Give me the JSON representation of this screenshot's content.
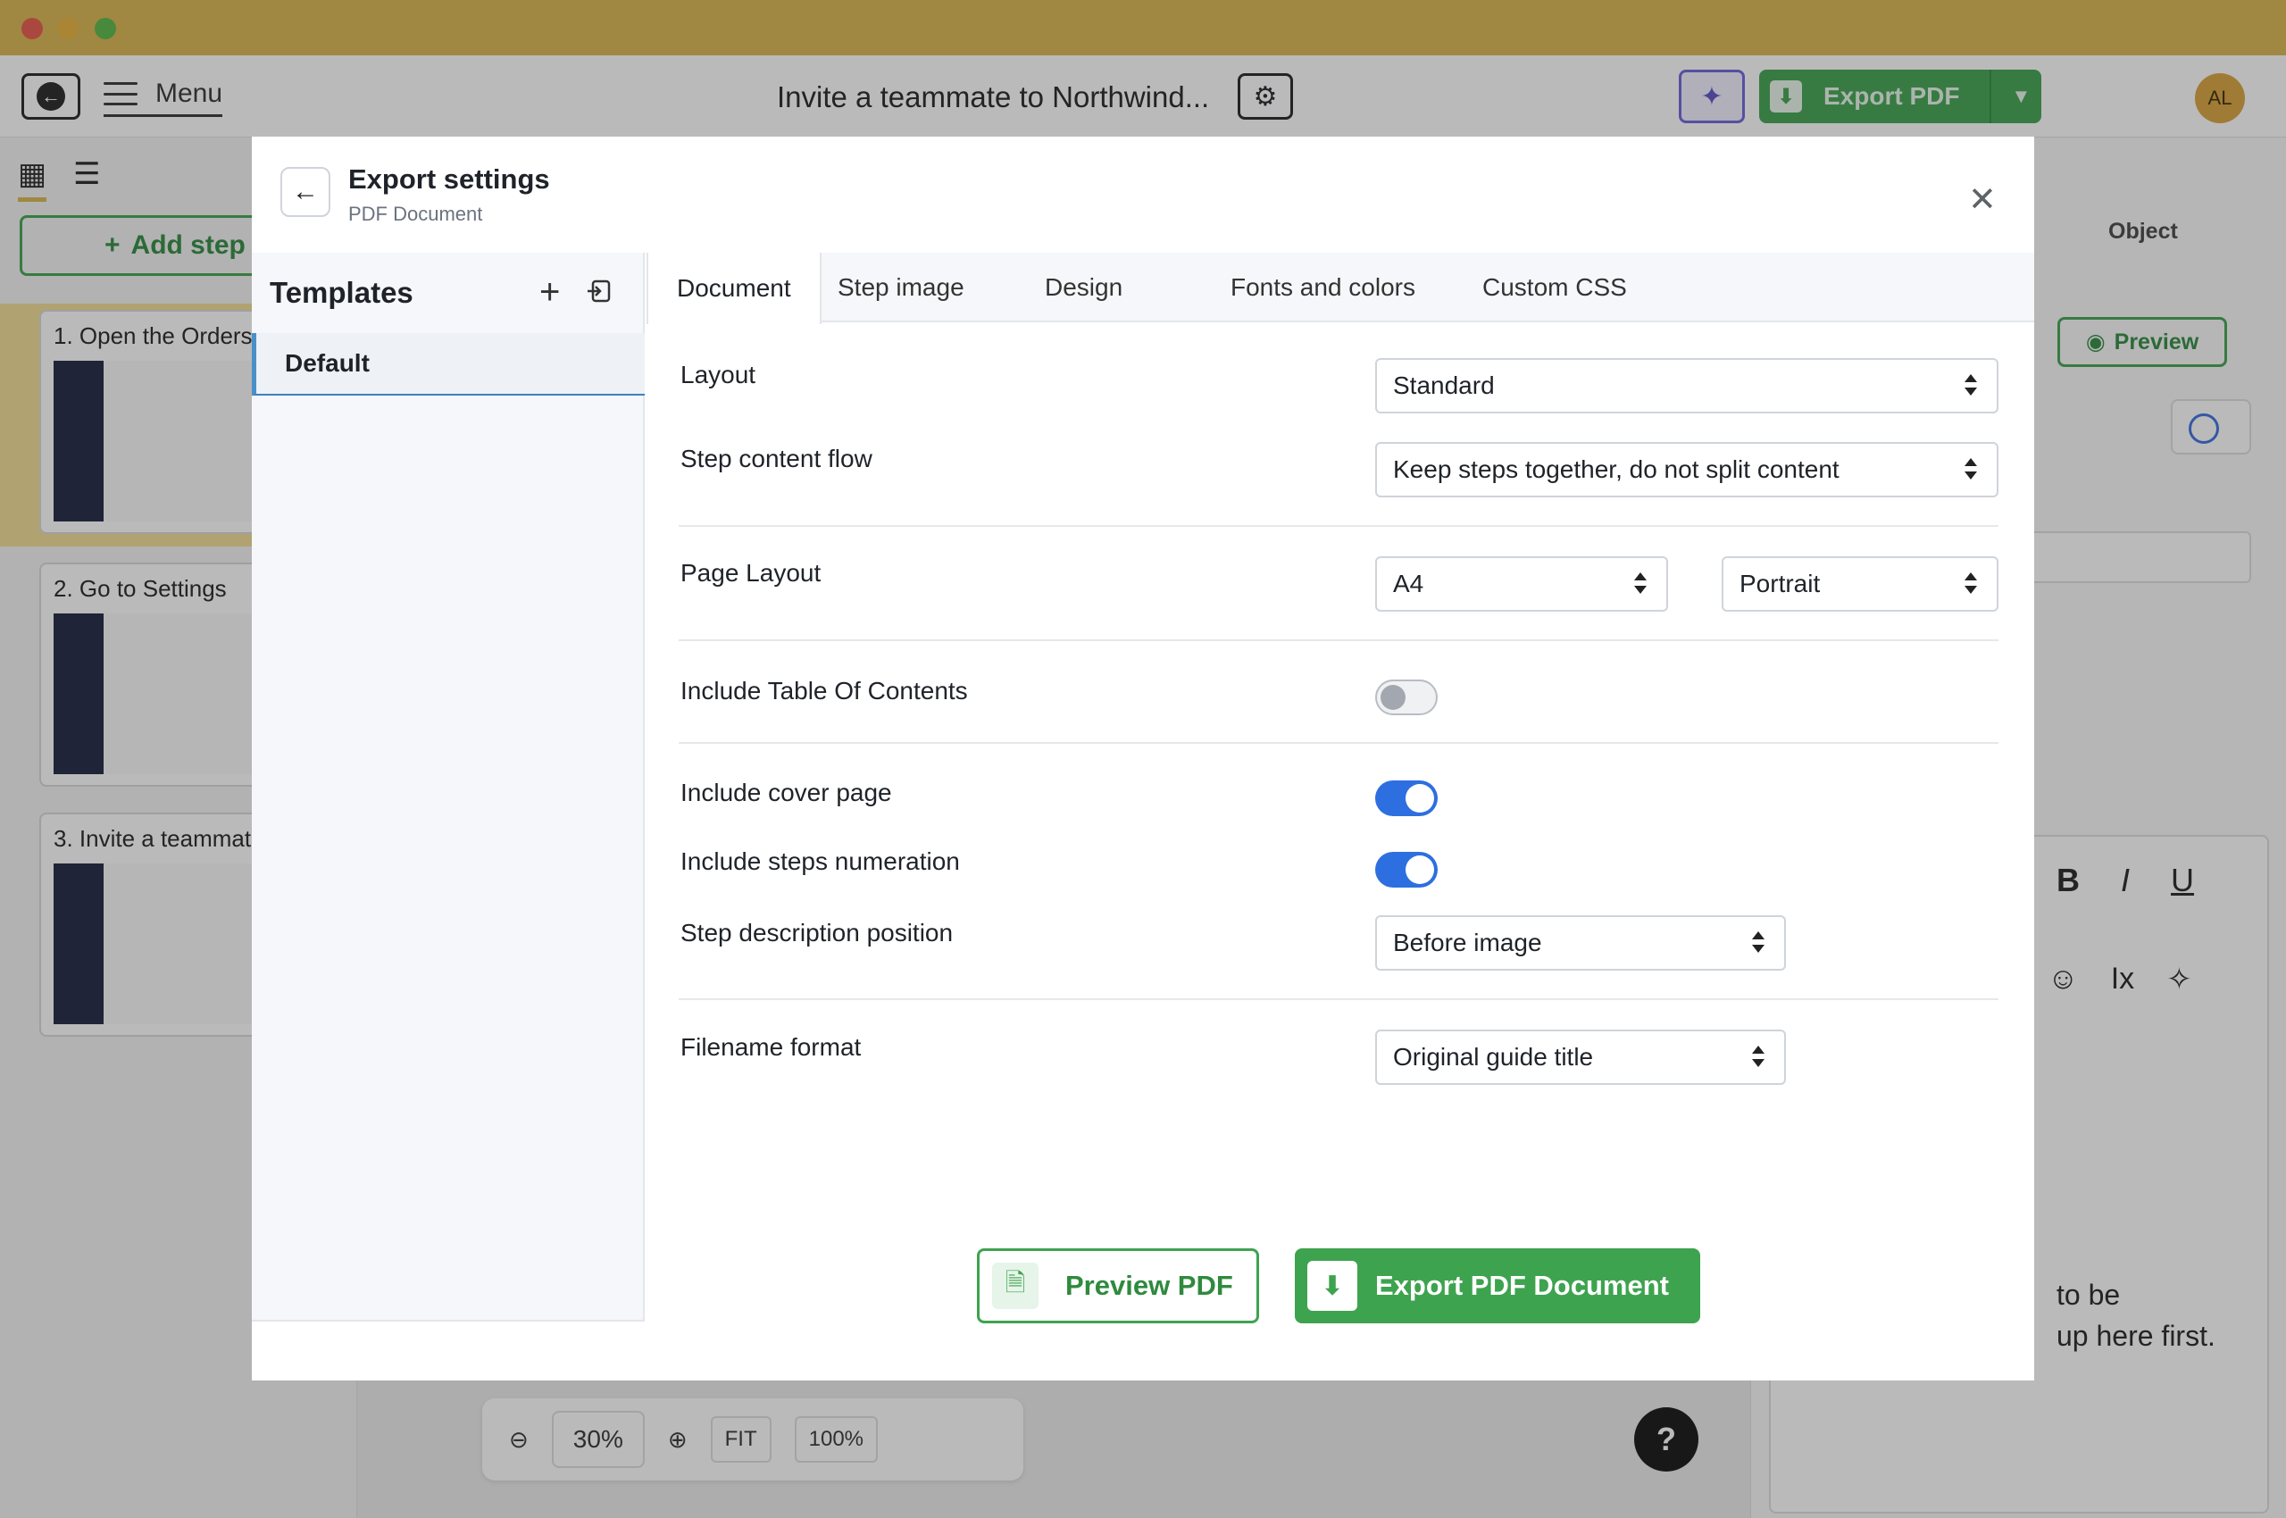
{
  "app": {
    "menu_label": "Menu",
    "guide_title": "Invite a teammate to Northwind...",
    "export_label": "Export PDF",
    "avatar_initials": "AL",
    "add_step_label": "Add step",
    "steps": [
      {
        "title": "1. Open the Orders"
      },
      {
        "title": "2. Go to Settings"
      },
      {
        "title": "3. Invite a teammate"
      }
    ],
    "zoom_level": "30%",
    "zoom_fit": "FIT",
    "zoom_100": "100%",
    "help_label": "?",
    "right_panel": {
      "object_label": "Object",
      "preview_label": "Preview",
      "text_line1": "to be",
      "text_line2": "up here first."
    }
  },
  "modal": {
    "title": "Export settings",
    "subtitle": "PDF Document",
    "templates": {
      "heading": "Templates",
      "items": [
        {
          "label": "Default"
        }
      ]
    },
    "tabs": [
      {
        "label": "Document"
      },
      {
        "label": "Step image"
      },
      {
        "label": "Design"
      },
      {
        "label": "Fonts and colors"
      },
      {
        "label": "Custom CSS"
      }
    ],
    "fields": {
      "layout": {
        "label": "Layout",
        "value": "Standard"
      },
      "step_content_flow": {
        "label": "Step content flow",
        "value": "Keep steps together, do not split content"
      },
      "page_layout": {
        "label": "Page Layout",
        "size": "A4",
        "orientation": "Portrait"
      },
      "include_toc": {
        "label": "Include Table Of Contents",
        "checked": false
      },
      "include_cover": {
        "label": "Include cover page",
        "checked": true
      },
      "include_numeration": {
        "label": "Include steps numeration",
        "checked": true
      },
      "description_position": {
        "label": "Step description position",
        "value": "Before image"
      },
      "filename_format": {
        "label": "Filename format",
        "value": "Original guide title"
      }
    },
    "buttons": {
      "preview": "Preview PDF",
      "export": "Export PDF Document"
    }
  },
  "colors": {
    "brand_green": "#3ea34f",
    "toggle_on": "#2d6fe0",
    "titlebar": "#d9b54f"
  }
}
